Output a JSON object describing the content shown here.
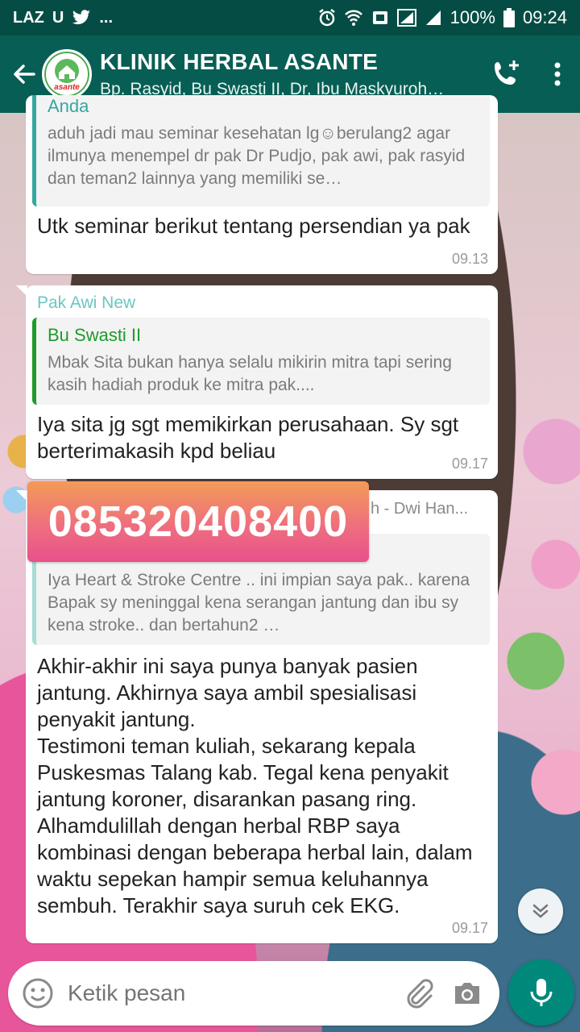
{
  "status_bar": {
    "left_icons": [
      "LAZ",
      "U",
      "twitter-icon",
      "..."
    ],
    "battery": "100%",
    "time": "09:24"
  },
  "header": {
    "title": "KLINIK HERBAL ASANTE",
    "subtitle": "Bp. Rasyid, Bu Swasti II, Dr, Ibu Maskyuroh…",
    "avatar_logo_text": "asante"
  },
  "messages": [
    {
      "quote_author": "Anda",
      "quote_text": "aduh jadi mau seminar kesehatan lg☺berulang2 agar ilmunya menempel dr pak Dr Pudjo, pak awi, pak rasyid dan teman2 lainnya yang memiliki se…",
      "text": "Utk seminar berikut tentang persendian ya pak",
      "time": "09.13"
    },
    {
      "sender": "Pak Awi New",
      "quote_author": "Bu Swasti II",
      "quote_text": "Mbak Sita bukan hanya selalu mikirin mitra tapi sering kasih hadiah produk ke mitra pak....",
      "text": "Iya sita jg sgt memikirkan perusahaan.  Sy sgt berterimakasih kpd beliau",
      "time": "09.17"
    },
    {
      "sender_tail": "h - Dwi Han...",
      "phone_overlay": "085320408400",
      "quote_text": "Iya Heart & Stroke Centre .. ini impian saya pak.. karena Bapak sy meninggal kena serangan jantung dan ibu sy kena stroke.. dan bertahun2 …",
      "text": "Akhir-akhir ini saya punya banyak pasien jantung. Akhirnya saya ambil spesialisasi penyakit jantung.\nTestimoni teman kuliah, sekarang kepala Puskesmas Talang kab. Tegal kena penyakit jantung koroner, disarankan pasang ring. Alhamdulillah dengan herbal RBP saya kombinasi dengan beberapa herbal lain, dalam waktu sepekan hampir semua keluhannya sembuh. Terakhir saya suruh cek EKG.",
      "time": "09.17"
    }
  ],
  "input": {
    "placeholder": "Ketik pesan"
  },
  "colors": {
    "status_bar": "#054d44",
    "app_bar": "#075e54",
    "quote_author_teal": "#35a7a0",
    "sender_awi": "#6cc7c0",
    "quote_author_green": "#1e9b2b",
    "mic_button": "#00897b"
  },
  "icons": {
    "back": "arrow-left-icon",
    "call": "add-call-icon",
    "menu": "more-vert-icon",
    "emoji": "emoji-icon",
    "attach": "paperclip-icon",
    "camera": "camera-icon",
    "mic": "mic-icon",
    "scroll_down": "double-chevron-down-icon"
  }
}
